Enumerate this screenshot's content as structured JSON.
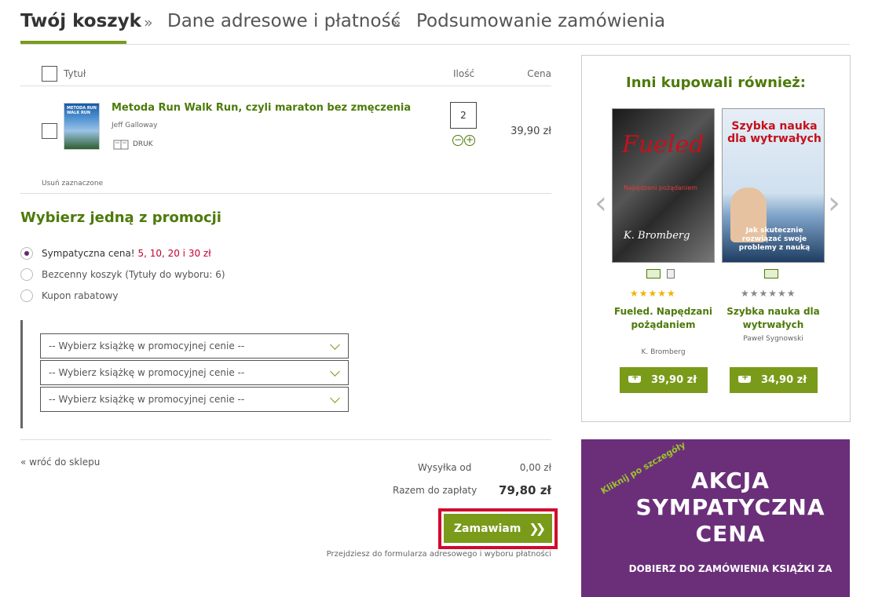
{
  "steps": [
    {
      "label": "Twój koszyk",
      "active": true
    },
    {
      "label": "Dane adresowe i płatność",
      "active": false
    },
    {
      "label": "Podsumowanie zamówienia",
      "active": false
    }
  ],
  "step_separator": "»",
  "cart": {
    "col_title": "Tytuł",
    "col_qty": "Ilość",
    "col_price": "Cena",
    "item": {
      "title": "Metoda Run Walk Run, czyli maraton bez zmęczenia",
      "author": "Jeff Galloway",
      "format": "DRUK",
      "quantity": "2",
      "price": "39,90 zł",
      "cover_text": "METODA RUN WALK RUN"
    },
    "remove_selected": "Usuń zaznaczone"
  },
  "promo": {
    "title": "Wybierz jedną z promocji",
    "options": [
      {
        "label": "Sympatyczna cena!",
        "highlight": "5, 10, 20 i 30 zł",
        "selected": true
      },
      {
        "label": "Bezcenny koszyk (Tytuły do wyboru: 6)",
        "highlight": "",
        "selected": false
      },
      {
        "label": "Kupon rabatowy",
        "highlight": "",
        "selected": false
      }
    ],
    "select_placeholder": "-- Wybierz książkę w promocyjnej cenie --"
  },
  "summary": {
    "back_link": "«  wróć do sklepu",
    "shipping_label": "Wysyłka od",
    "shipping_value": "0,00 zł",
    "total_label": "Razem do zapłaty",
    "total_value": "79,80 zł",
    "order_button": "Zamawiam",
    "order_note": "Przejdziesz do formularza adresowego i wyboru płatności"
  },
  "recommendations": {
    "title": "Inni kupowali również:",
    "items": [
      {
        "title": "Fueled. Napędzani pożądaniem",
        "author": "K. Bromberg",
        "price": "39,90 zł",
        "rating": 5,
        "cover_title": "Fueled",
        "cover_subtitle": "Napędzani pożądaniem",
        "cover_author": "K. Bromberg"
      },
      {
        "title": "Szybka nauka dla wytrwałych",
        "author": "Paweł Sygnowski",
        "price": "34,90 zł",
        "rating": 0,
        "cover_title": "Szybka nauka dla wytrwałych",
        "cover_subtitle": "Jak skutecznie rozwiązać swoje problemy z nauką"
      }
    ]
  },
  "banner": {
    "click_text": "Kliknij po szczegóły",
    "headline": "AKCJA SYMPATYCZNA CENA",
    "subline": "DOBIERZ DO ZAMÓWIENIA KSIĄŻKI ZA",
    "background": "#6b2f7a"
  },
  "colors": {
    "accent": "#7a9a1a",
    "title_green": "#4d7a0a",
    "highlight_red": "#c2002f",
    "frame_red": "#d10a2e"
  }
}
